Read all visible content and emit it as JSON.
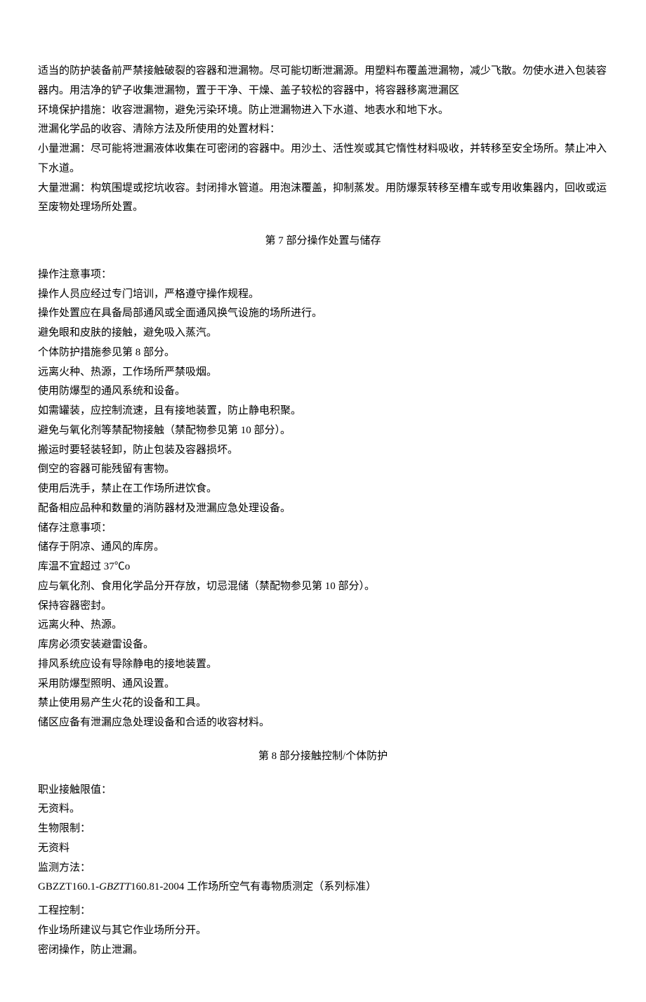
{
  "intro": {
    "p1": "适当的防护装备前严禁接触破裂的容器和泄漏物。尽可能切断泄漏源。用塑料布覆盖泄漏物，减少飞散。勿使水进入包装容器内。用洁净的铲子收集泄漏物，置于干净、干燥、盖子较松的容器中，将容器移离泄漏区",
    "p2": "环境保护措施：收容泄漏物，避免污染环境。防止泄漏物进入下水道、地表水和地下水。",
    "p3": "泄漏化学品的收容、清除方法及所使用的处置材料：",
    "p4": "小量泄漏：尽可能将泄漏液体收集在可密闭的容器中。用沙土、活性炭或其它惰性材料吸收，并转移至安全场所。禁止冲入下水道。",
    "p5": "大量泄漏：构筑围堤或挖坑收容。封闭排水管道。用泡沫覆盖，抑制蒸发。用防爆泵转移至槽车或专用收集器内，回收或运至废物处理场所处置。"
  },
  "section7": {
    "heading": "第 7 部分操作处置与储存",
    "l1": "操作注意事项：",
    "l2": "操作人员应经过专门培训，严格遵守操作规程。",
    "l3": "操作处置应在具备局部通风或全面通风换气设施的场所进行。",
    "l4": "避免眼和皮肤的接触，避免吸入蒸汽。",
    "l5": "个体防护措施参见第 8 部分。",
    "l6": "远离火种、热源，工作场所严禁吸烟。",
    "l7": "使用防爆型的通风系统和设备。",
    "l8": "如需罐装，应控制流速，且有接地装置，防止静电积聚。",
    "l9": "避免与氧化剂等禁配物接触（禁配物参见第 10 部分）。",
    "l10": "搬运时要轻装轻卸，防止包装及容器损坏。",
    "l11": "倒空的容器可能残留有害物。",
    "l12": "使用后洗手，禁止在工作场所进饮食。",
    "l13": "配备相应品种和数量的消防器材及泄漏应急处理设备。",
    "l14": "储存注意事项：",
    "l15": "储存于阴凉、通风的库房。",
    "l16": "库温不宜超过 37℃o",
    "l17": "应与氧化剂、食用化学品分开存放，切忌混储（禁配物参见第 10 部分）。",
    "l18": "保持容器密封。",
    "l19": "远离火种、热源。",
    "l20": "库房必须安装避雷设备。",
    "l21": "排风系统应设有导除静电的接地装置。",
    "l22": "采用防爆型照明、通风设置。",
    "l23": "禁止使用易产生火花的设备和工具。",
    "l24": "储区应备有泄漏应急处理设备和合适的收容材料。"
  },
  "section8": {
    "heading": "第 8 部分接触控制/个体防护",
    "l1": "职业接触限值：",
    "l2": "无资料。",
    "l3": "生物限制：",
    "l4": "无资料",
    "l5": "监测方法：",
    "l6a": "GBZZT160.1-",
    "l6b": "GBZTT",
    "l6c": "160.81-2004 工作场所空气有毒物质测定（系列标准）",
    "l7": "工程控制：",
    "l8": "作业场所建议与其它作业场所分开。",
    "l9": "密闭操作，防止泄漏。"
  }
}
